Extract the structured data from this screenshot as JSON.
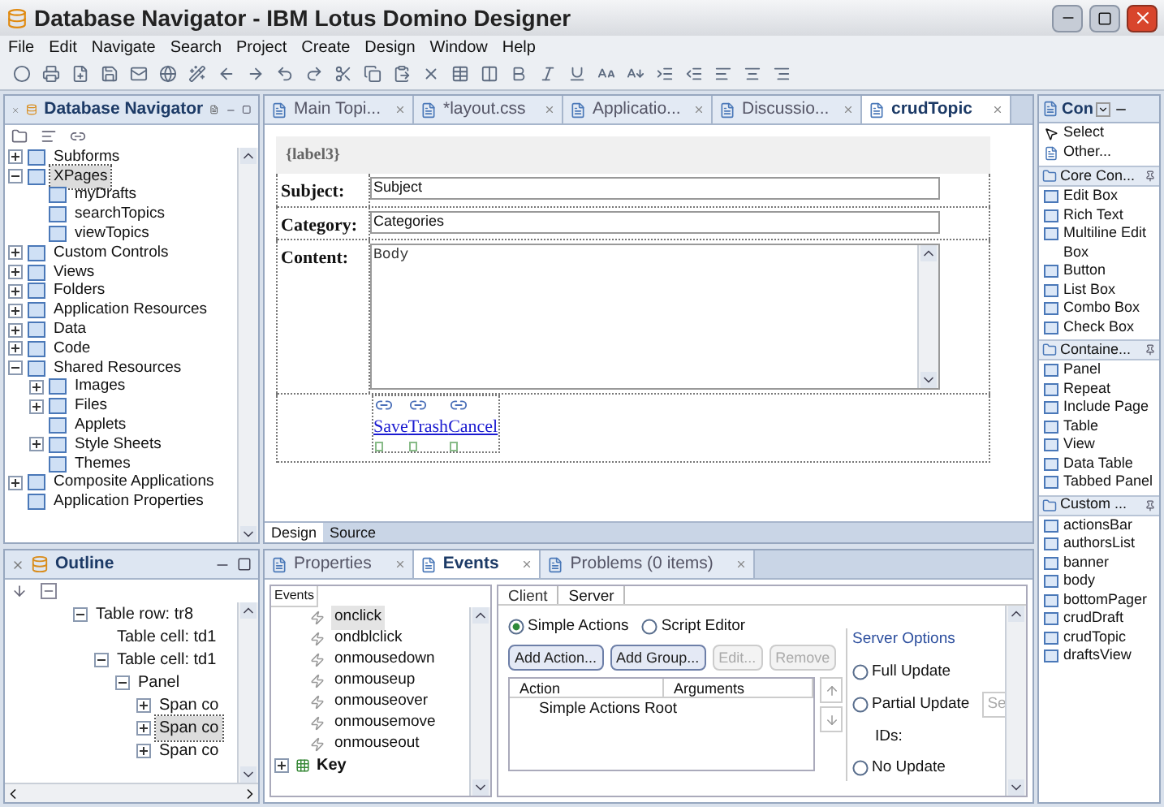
{
  "window": {
    "title": "Database Navigator - IBM Lotus Domino Designer"
  },
  "menu": [
    "File",
    "Edit",
    "Navigate",
    "Search",
    "Project",
    "Create",
    "Design",
    "Window",
    "Help"
  ],
  "navigator": {
    "title": "Database Navigator",
    "tree": [
      {
        "label": "Subforms",
        "expanded": false,
        "selected": false
      },
      {
        "label": "XPages",
        "expanded": true,
        "selected": true,
        "children": [
          {
            "label": "myDrafts",
            "selected": false
          },
          {
            "label": "searchTopics",
            "selected": false
          },
          {
            "label": "viewTopics",
            "selected": false
          }
        ]
      },
      {
        "label": "Custom Controls",
        "expanded": false,
        "selected": false
      },
      {
        "label": "Views",
        "expanded": false,
        "selected": false
      },
      {
        "label": "Folders",
        "expanded": false,
        "selected": false
      },
      {
        "label": "Application Resources",
        "expanded": false,
        "selected": false
      },
      {
        "label": "Data",
        "expanded": false,
        "selected": false
      },
      {
        "label": "Code",
        "expanded": false,
        "selected": false
      },
      {
        "label": "Shared Resources",
        "expanded": true,
        "selected": false,
        "children": [
          {
            "label": "Images",
            "expanded": false,
            "selected": false
          },
          {
            "label": "Files",
            "expanded": false,
            "selected": false
          },
          {
            "label": "Applets",
            "selected": false
          },
          {
            "label": "Style Sheets",
            "expanded": false,
            "selected": false
          },
          {
            "label": "Themes",
            "selected": false
          }
        ]
      },
      {
        "label": "Composite Applications",
        "expanded": false,
        "selected": false
      },
      {
        "label": "Application Properties",
        "selected": false
      }
    ]
  },
  "outline": {
    "title": "Outline",
    "tree": [
      {
        "label": "Table row: tr8",
        "expanded": true,
        "selected": false,
        "children": [
          {
            "label": "Table cell: td1",
            "selected": false
          },
          {
            "label": "Table cell: td1",
            "expanded": true,
            "selected": false,
            "children": [
              {
                "label": "Panel",
                "expanded": true,
                "selected": false,
                "children": [
                  {
                    "label": "Span co",
                    "expanded": false,
                    "selected": false
                  },
                  {
                    "label": "Span co",
                    "expanded": false,
                    "selected": true
                  },
                  {
                    "label": "Span co",
                    "expanded": false,
                    "selected": false
                  }
                ]
              }
            ]
          }
        ]
      }
    ]
  },
  "editor_tabs": [
    {
      "label": "Main Topi...",
      "selected": false
    },
    {
      "label": "*layout.css",
      "selected": false
    },
    {
      "label": "Applicatio...",
      "selected": false
    },
    {
      "label": "Discussio...",
      "selected": false
    },
    {
      "label": "crudTopic",
      "selected": true
    }
  ],
  "form": {
    "header": "{label3}",
    "fields": [
      {
        "label": "Subject:",
        "value": "Subject",
        "kind": "input"
      },
      {
        "label": "Category:",
        "value": "Categories",
        "kind": "input"
      },
      {
        "label": "Content:",
        "value": "Body",
        "kind": "textarea"
      }
    ],
    "links": [
      "Save",
      "Trash",
      "Cancel"
    ]
  },
  "view_tabs": [
    {
      "label": "Design",
      "selected": true
    },
    {
      "label": "Source",
      "selected": false
    }
  ],
  "bottom_tabs": [
    {
      "label": "Properties",
      "selected": false
    },
    {
      "label": "Events",
      "selected": true
    },
    {
      "label": "Problems (0 items)",
      "selected": false
    }
  ],
  "events": {
    "header": "Events",
    "items": [
      {
        "label": "onclick",
        "selected": true
      },
      {
        "label": "ondblclick",
        "selected": false
      },
      {
        "label": "onmousedown",
        "selected": false
      },
      {
        "label": "onmouseup",
        "selected": false
      },
      {
        "label": "onmouseover",
        "selected": false
      },
      {
        "label": "onmousemove",
        "selected": false
      },
      {
        "label": "onmouseout",
        "selected": false
      }
    ],
    "group": {
      "label": "Key",
      "expanded": false
    }
  },
  "side_tabs": [
    {
      "label": "Client",
      "selected": false
    },
    {
      "label": "Server",
      "selected": true
    }
  ],
  "modes": [
    {
      "label": "Simple Actions",
      "selected": true
    },
    {
      "label": "Script Editor",
      "selected": false
    }
  ],
  "action_buttons": [
    {
      "label": "Add Action...",
      "disabled": false
    },
    {
      "label": "Add Group...",
      "disabled": false
    },
    {
      "label": "Edit...",
      "disabled": true
    },
    {
      "label": "Remove",
      "disabled": true
    }
  ],
  "actions_table": {
    "columns": [
      "Action",
      "Arguments"
    ],
    "rows": [
      "Simple Actions Root"
    ]
  },
  "server_options": {
    "title": "Server Options",
    "options": [
      {
        "label": "Full Update",
        "selected": false
      },
      {
        "label": "Partial Update",
        "selected": false
      },
      {
        "label": "No Update",
        "selected": false
      }
    ],
    "select_button": "Se",
    "ids_label": "IDs:"
  },
  "palette": {
    "title": "Con",
    "top_items": [
      "Select",
      "Other..."
    ],
    "sections": [
      {
        "title": "Core Con...",
        "items": [
          "Edit Box",
          "Rich Text",
          "Multiline Edit Box",
          "Button",
          "List Box",
          "Combo Box",
          "Check Box"
        ]
      },
      {
        "title": "Containe...",
        "items": [
          "Panel",
          "Repeat",
          "Include Page",
          "Table",
          "View",
          "Data Table",
          "Tabbed Panel"
        ]
      },
      {
        "title": "Custom ...",
        "items": [
          "actionsBar",
          "authorsList",
          "banner",
          "body",
          "bottomPager",
          "crudDraft",
          "crudTopic",
          "draftsView"
        ]
      }
    ]
  }
}
